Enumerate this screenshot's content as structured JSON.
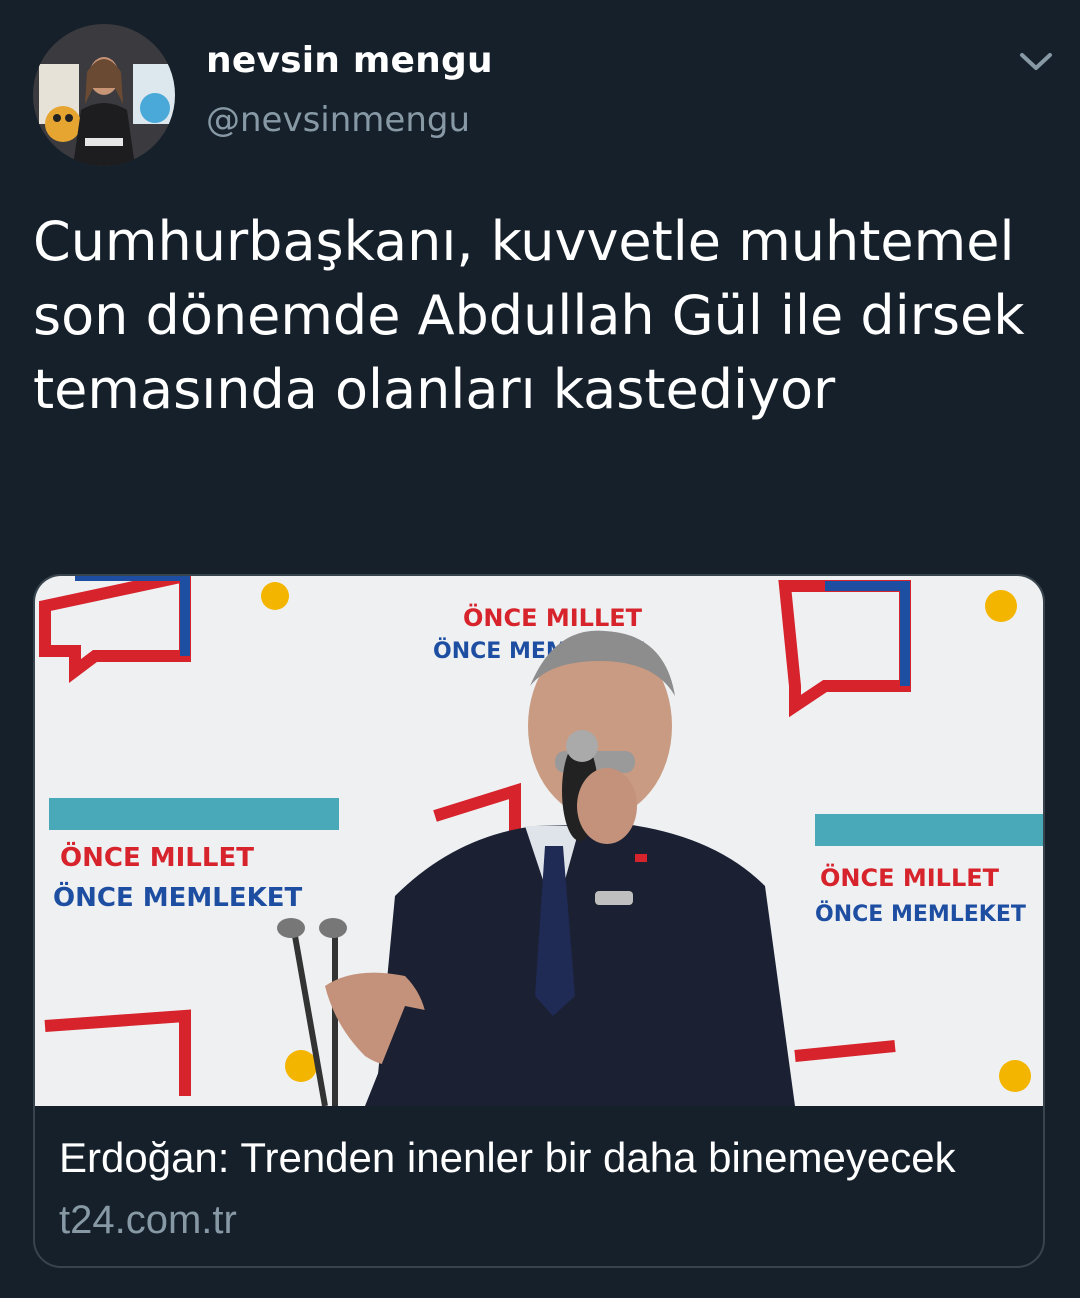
{
  "user": {
    "display_name": "nevsin mengu",
    "handle": "@nevsinmengu"
  },
  "tweet": {
    "text": "Cumhurbaşkanı, kuvvetle muhtemel son dönemde Abdullah Gül ile dirsek temasında olanları kastediyor"
  },
  "link_card": {
    "title": "Erdoğan: Trenden inenler bir daha binemeyecek",
    "domain": "t24.com.tr",
    "banner_text_red": "ÖNCE MILLET",
    "banner_text_blue": "ÖNCE MEMLEKET"
  },
  "icons": {
    "menu": "chevron-down-icon",
    "avatar": "profile-photo"
  },
  "colors": {
    "background": "#15202b",
    "secondary_text": "#8899a6",
    "border": "#38444d"
  }
}
